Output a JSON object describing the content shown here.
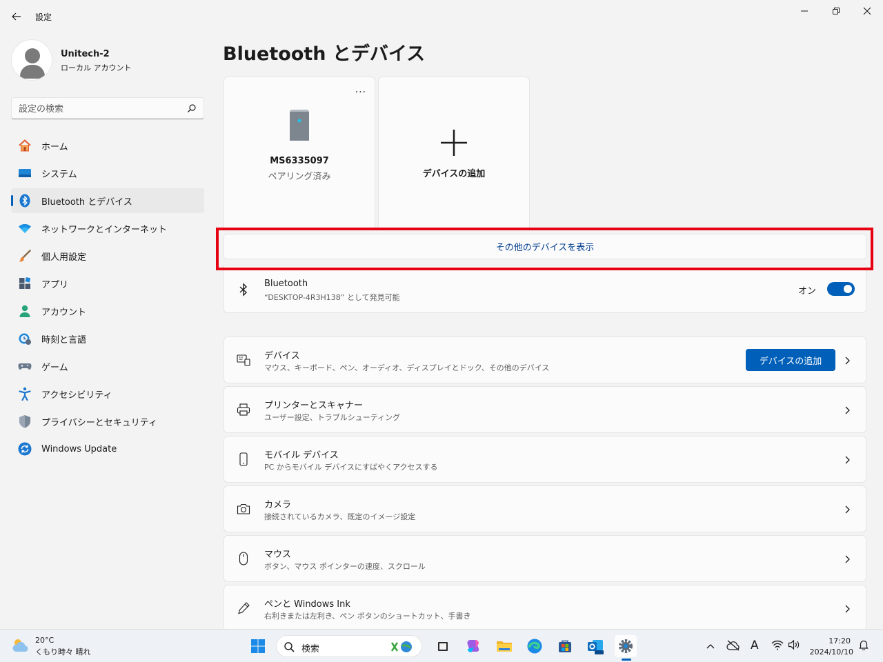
{
  "window": {
    "title": "設定"
  },
  "profile": {
    "name": "Unitech-2",
    "account_type": "ローカル アカウント"
  },
  "search": {
    "placeholder": "設定の検索"
  },
  "sidebar": {
    "items": [
      {
        "label": "ホーム",
        "icon": "home-icon"
      },
      {
        "label": "システム",
        "icon": "system-icon"
      },
      {
        "label": "Bluetooth とデバイス",
        "icon": "bluetooth-icon",
        "active": true
      },
      {
        "label": "ネットワークとインターネット",
        "icon": "wifi-icon"
      },
      {
        "label": "個人用設定",
        "icon": "brush-icon"
      },
      {
        "label": "アプリ",
        "icon": "apps-icon"
      },
      {
        "label": "アカウント",
        "icon": "account-icon"
      },
      {
        "label": "時刻と言語",
        "icon": "time-language-icon"
      },
      {
        "label": "ゲーム",
        "icon": "gamepad-icon"
      },
      {
        "label": "アクセシビリティ",
        "icon": "accessibility-icon"
      },
      {
        "label": "プライバシーとセキュリティ",
        "icon": "shield-icon"
      },
      {
        "label": "Windows Update",
        "icon": "windows-update-icon"
      }
    ]
  },
  "main": {
    "title": "Bluetooth とデバイス",
    "device_tiles": [
      {
        "name": "MS6335097",
        "status": "ペアリング済み",
        "more": "..."
      },
      {
        "add_label": "デバイスの追加"
      }
    ],
    "show_more_label": "その他のデバイスを表示",
    "bluetooth": {
      "title": "Bluetooth",
      "subtitle": "“DESKTOP-4R3H138” として発見可能",
      "toggle_label": "オン",
      "enabled": true
    },
    "rows": [
      {
        "title": "デバイス",
        "subtitle": "マウス、キーボード、ペン、オーディオ、ディスプレイとドック、その他のデバイス",
        "button": "デバイスの追加",
        "icon": "keyboard-device-icon"
      },
      {
        "title": "プリンターとスキャナー",
        "subtitle": "ユーザー設定、トラブルシューティング",
        "icon": "printer-icon"
      },
      {
        "title": "モバイル デバイス",
        "subtitle": "PC からモバイル デバイスにすばやくアクセスする",
        "icon": "phone-icon"
      },
      {
        "title": "カメラ",
        "subtitle": "接続されているカメラ、既定のイメージ設定",
        "icon": "camera-icon"
      },
      {
        "title": "マウス",
        "subtitle": "ボタン、マウス ポインターの速度、スクロール",
        "icon": "mouse-icon"
      },
      {
        "title": "ペンと Windows Ink",
        "subtitle": "右利きまたは左利き、ペン ボタンのショートカット、手書き",
        "icon": "pen-icon"
      }
    ]
  },
  "taskbar": {
    "weather_temp": "20°C",
    "weather_desc": "くもり時々 晴れ",
    "search_label": "検索",
    "time": "17:20",
    "date": "2024/10/10",
    "ime_label": "A"
  },
  "colors": {
    "accent": "#005fb8",
    "highlight_box": "#e60012",
    "link_text": "#003e92"
  }
}
